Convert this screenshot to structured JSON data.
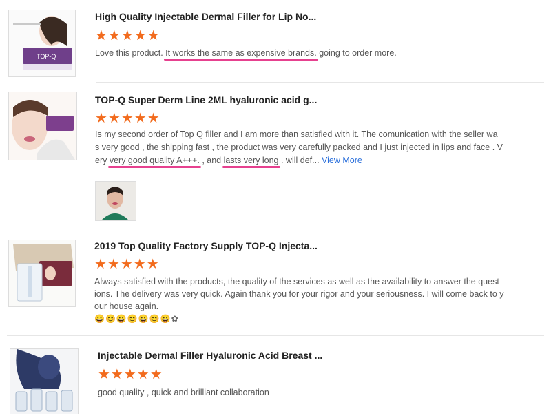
{
  "reviews": [
    {
      "title": "High Quality Injectable Dermal Filler for Lip No...",
      "stars": "★★★★★",
      "text_parts": [
        "Love this product.  ",
        "It works the same as expensive brands.",
        "  going to order more."
      ],
      "thumb_brand": "TOP-Q"
    },
    {
      "title": "TOP-Q Super Derm Line 2ML hyaluronic acid g...",
      "stars": "★★★★★",
      "text_line1": "Is my second order of Top Q filler and I am more than satisfied with it. The comunication with the seller wa",
      "text_line2": "s very good , the shipping fast , the product was very carefully packed and I just injected in lips and face . V",
      "text_line3_parts": [
        "ery ",
        "very good quality A+++.",
        " , and ",
        "lasts very long",
        " . will def... "
      ],
      "view_more": "View More"
    },
    {
      "title": "2019 Top Quality Factory Supply TOP-Q Injecta...",
      "stars": "★★★★★",
      "text_line1": "Always satisfied with the products, the quality of the services as well as the availability to answer the quest",
      "text_line2": "ions. The delivery was very quick. Again thank you for your rigor and your seriousness. I will come back to y",
      "text_line3": "our house again.",
      "emoji": "😀😊😀😊😀😊😀✿"
    },
    {
      "title": "Injectable Dermal Filler Hyaluronic Acid Breast ...",
      "stars": "★★★★★",
      "text": "good quality , quick and brilliant  collaboration"
    }
  ],
  "colors": {
    "star": "#f26b1d",
    "underline": "#e6418f",
    "link": "#2a6fdb"
  }
}
